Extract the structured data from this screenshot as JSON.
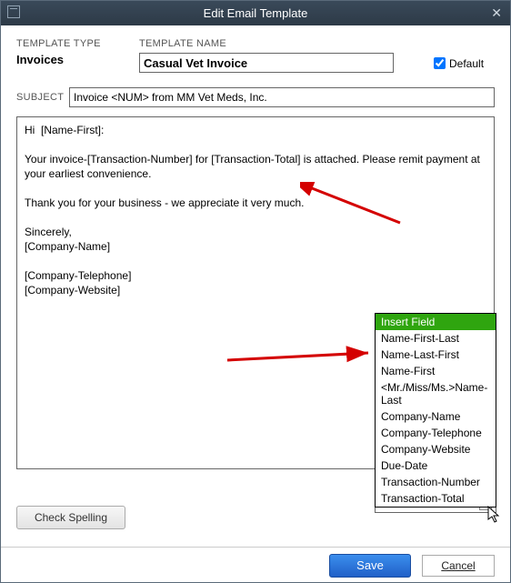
{
  "window": {
    "title": "Edit Email Template"
  },
  "labels": {
    "template_type": "TEMPLATE TYPE",
    "template_name": "TEMPLATE NAME",
    "subject": "SUBJECT",
    "default": "Default"
  },
  "values": {
    "template_type": "Invoices",
    "template_name": "Casual Vet Invoice",
    "default_checked": true,
    "subject": "Invoice <NUM> from MM Vet Meds, Inc.",
    "body": "Hi  [Name-First]:\n\nYour invoice-[Transaction-Number] for [Transaction-Total] is attached. Please remit payment at your earliest convenience.\n\nThank you for your business - we appreciate it very much.\n\nSincerely,\n[Company-Name]\n\n[Company-Telephone]\n[Company-Website]"
  },
  "insert_field": {
    "header": "Insert Field",
    "selected": "Insert Field",
    "options": [
      "Name-First-Last",
      "Name-Last-First",
      "Name-First",
      "<Mr./Miss/Ms.>Name-Last",
      "Company-Name",
      "Company-Telephone",
      "Company-Website",
      "Due-Date",
      "Transaction-Number",
      "Transaction-Total"
    ]
  },
  "buttons": {
    "check_spelling": "Check Spelling",
    "save": "Save",
    "cancel": "Cancel"
  }
}
